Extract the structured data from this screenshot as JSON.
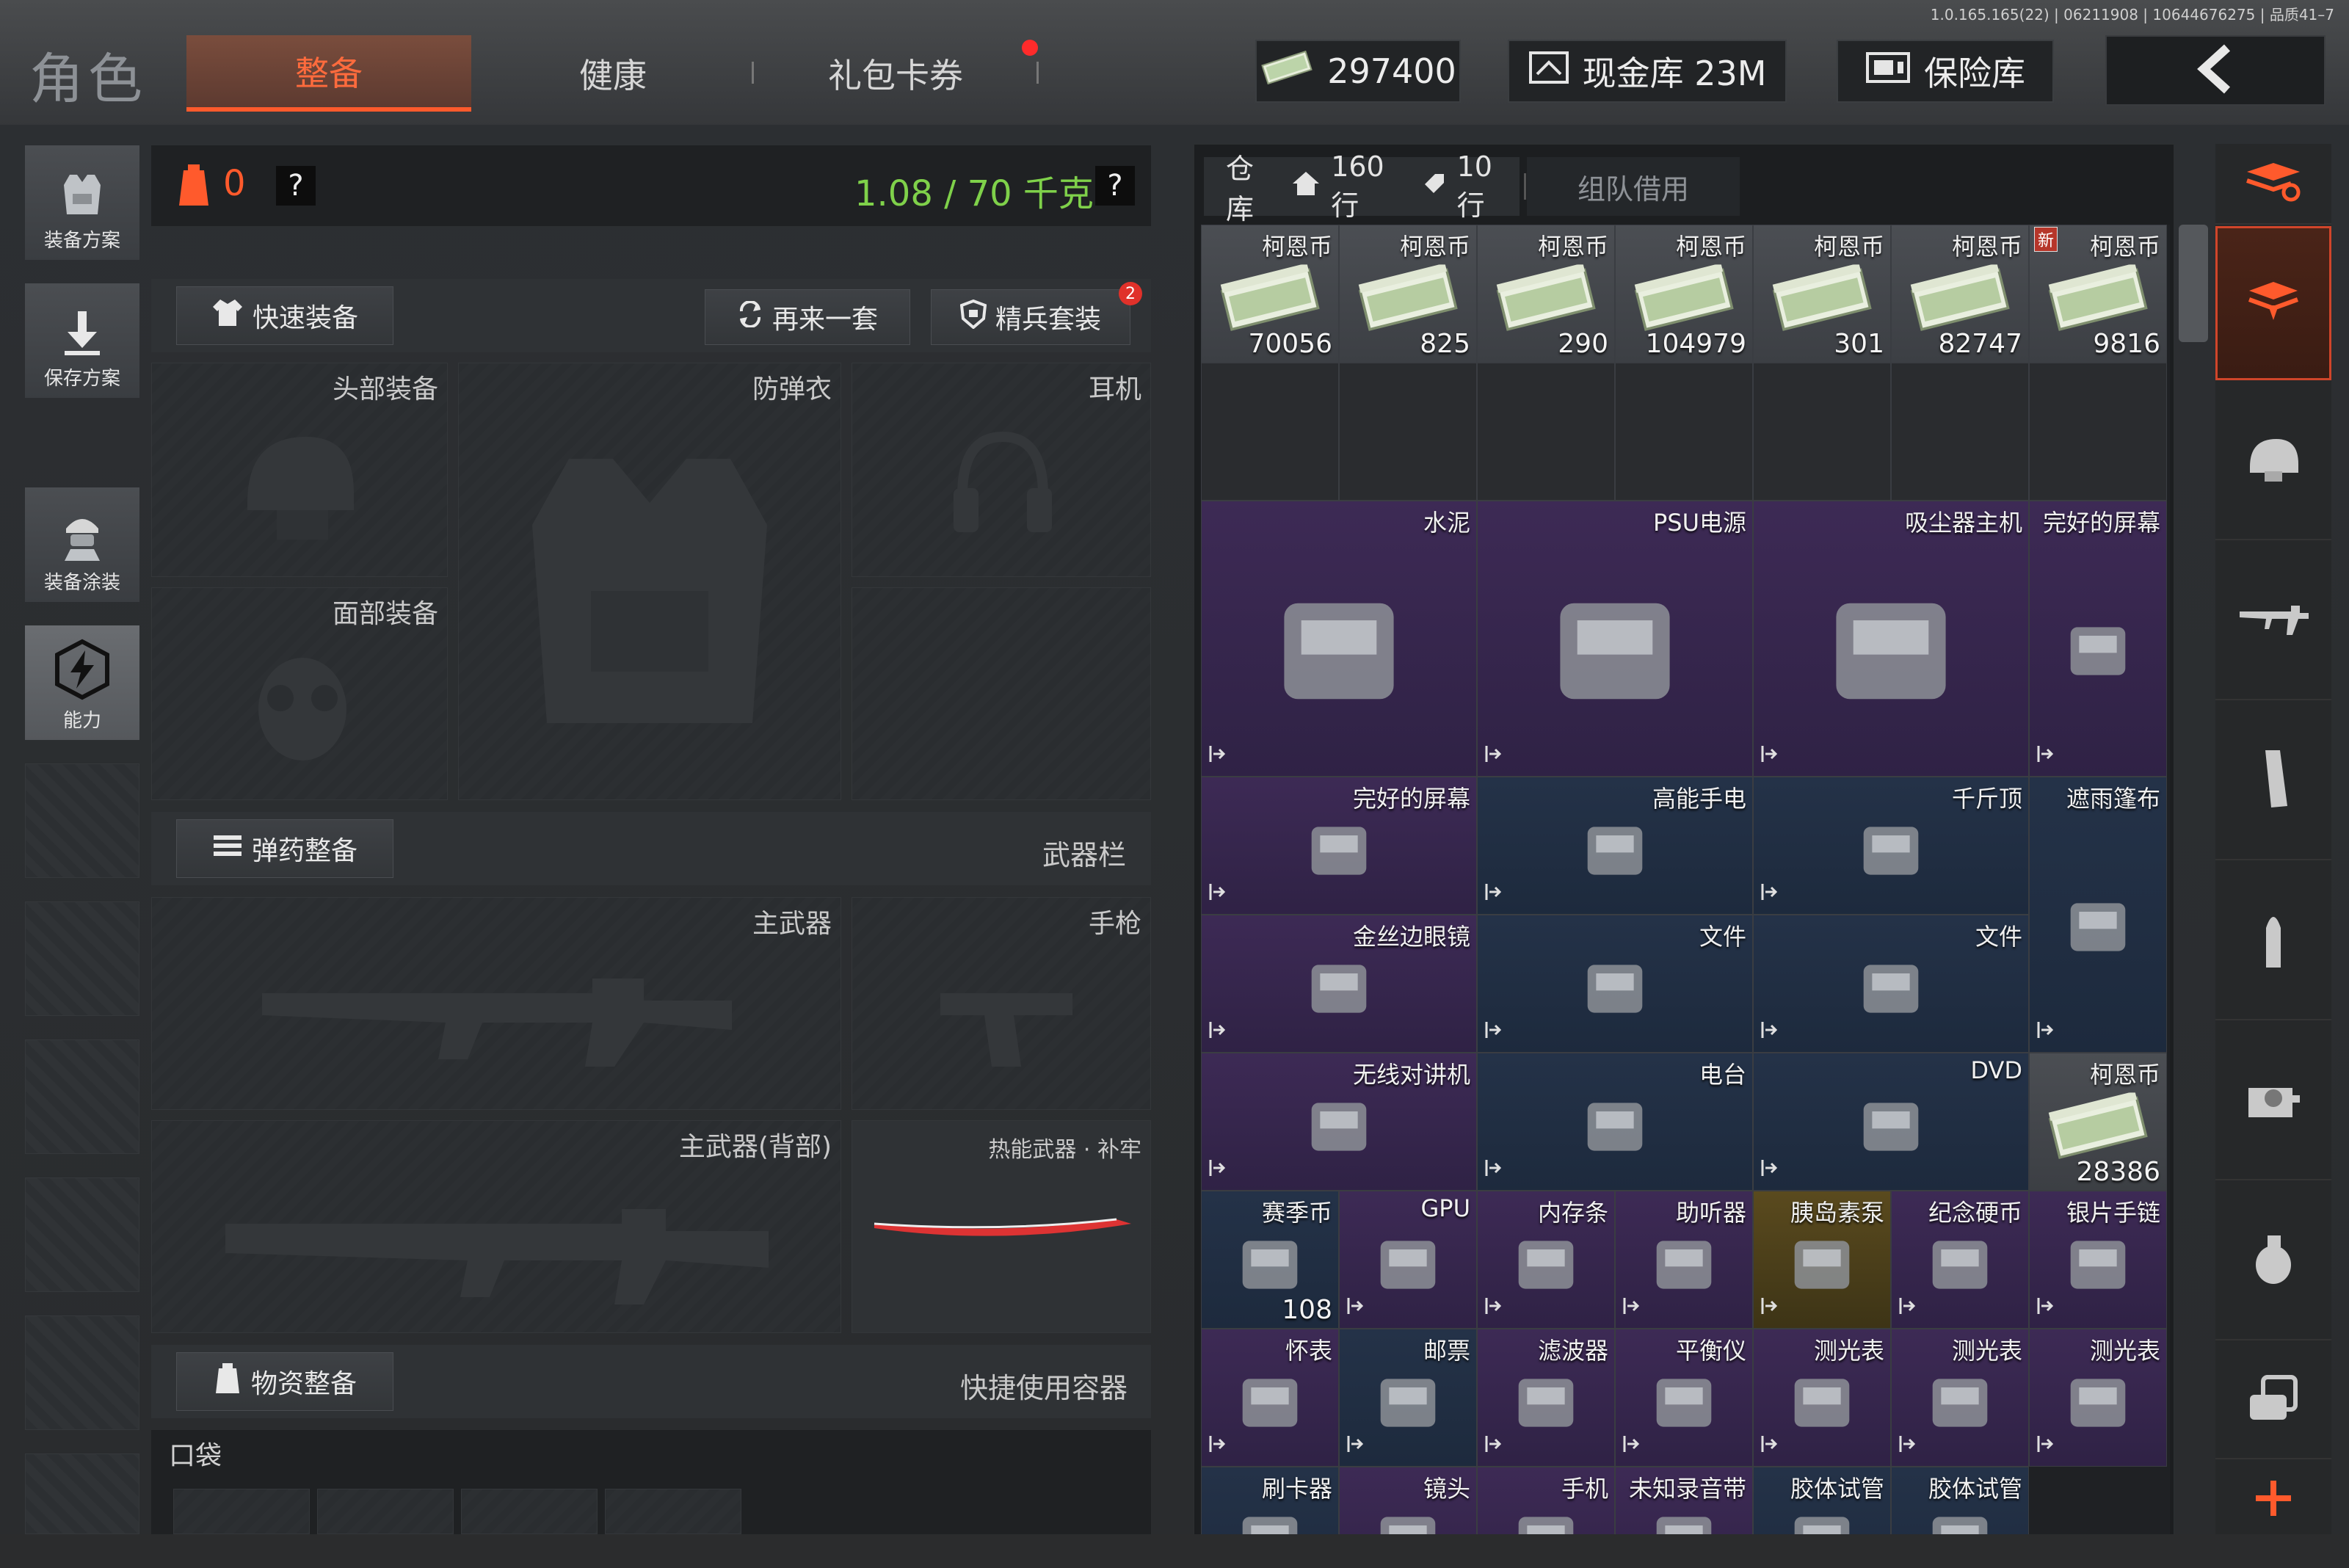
{
  "version": "1.0.165.165(22) | 06211908 | 10644676275 | 品质41–7",
  "title": "角色",
  "tabs": [
    {
      "label": "整备"
    },
    {
      "label": "健康"
    },
    {
      "label": "礼包卡券"
    }
  ],
  "currency": {
    "cash": "297400",
    "vault_label": "现金库 23M",
    "safe_label": "保险库"
  },
  "sidebar": {
    "items": [
      {
        "label": "装备方案"
      },
      {
        "label": "保存方案"
      },
      {
        "label": "装备涂装"
      },
      {
        "label": "能力"
      }
    ]
  },
  "status": {
    "armor_count": "0",
    "help": "?",
    "weight": "1.08 / 70 千克"
  },
  "actions": {
    "quick_equip": "快速装备",
    "retry": "再来一套",
    "elite": "精兵套装",
    "elite_badge": "2"
  },
  "slots": {
    "head": "头部装备",
    "armor": "防弹衣",
    "ear": "耳机",
    "face": "面部装备",
    "primary": "主武器",
    "pistol": "手枪",
    "primary_back": "主武器(背部)",
    "melee": "热能武器 · 补牢"
  },
  "sections": {
    "ammo": "弹药整备",
    "weapon_bar": "武器栏",
    "supply": "物资整备",
    "quick_container": "快捷使用容器",
    "pocket": "口袋"
  },
  "warehouse": {
    "tab_label": "仓库",
    "rows_a": "160行",
    "rows_b": "10行",
    "team_borrow": "组队借用",
    "new_badge": "新"
  },
  "items": [
    {
      "name": "柯恩币",
      "qty": "70056",
      "bg": "gray"
    },
    {
      "name": "柯恩币",
      "qty": "825",
      "bg": "gray"
    },
    {
      "name": "柯恩币",
      "qty": "290",
      "bg": "gray"
    },
    {
      "name": "柯恩币",
      "qty": "104979",
      "bg": "gray"
    },
    {
      "name": "柯恩币",
      "qty": "301",
      "bg": "gray"
    },
    {
      "name": "柯恩币",
      "qty": "82747",
      "bg": "gray"
    },
    {
      "name": "柯恩币",
      "qty": "9816",
      "bg": "gray"
    },
    {
      "name": "水泥",
      "qty": "",
      "bg": "purple"
    },
    {
      "name": "PSU电源",
      "qty": "",
      "bg": "purple"
    },
    {
      "name": "吸尘器主机",
      "qty": "",
      "bg": "purple"
    },
    {
      "name": "完好的屏幕",
      "qty": "",
      "bg": "purple"
    },
    {
      "name": "完好的屏幕",
      "qty": "",
      "bg": "purple"
    },
    {
      "name": "高能手电",
      "qty": "",
      "bg": "blue"
    },
    {
      "name": "千斤顶",
      "qty": "",
      "bg": "blue"
    },
    {
      "name": "遮雨篷布",
      "qty": "",
      "bg": "blue"
    },
    {
      "name": "金丝边眼镜",
      "qty": "",
      "bg": "purple"
    },
    {
      "name": "文件",
      "qty": "",
      "bg": "blue"
    },
    {
      "name": "文件",
      "qty": "",
      "bg": "blue"
    },
    {
      "name": "无线对讲机",
      "qty": "",
      "bg": "purple"
    },
    {
      "name": "电台",
      "qty": "",
      "bg": "blue"
    },
    {
      "name": "DVD",
      "qty": "",
      "bg": "blue"
    },
    {
      "name": "柯恩币",
      "qty": "28386",
      "bg": "gray"
    },
    {
      "name": "赛季币",
      "qty": "108",
      "bg": "blue"
    },
    {
      "name": "GPU",
      "qty": "",
      "bg": "purple"
    },
    {
      "name": "内存条",
      "qty": "",
      "bg": "purple"
    },
    {
      "name": "助听器",
      "qty": "",
      "bg": "purple"
    },
    {
      "name": "胰岛素泵",
      "qty": "",
      "bg": "gold"
    },
    {
      "name": "纪念硬币",
      "qty": "",
      "bg": "purple"
    },
    {
      "name": "银片手链",
      "qty": "",
      "bg": "purple"
    },
    {
      "name": "怀表",
      "qty": "",
      "bg": "purple"
    },
    {
      "name": "邮票",
      "qty": "",
      "bg": "blue"
    },
    {
      "name": "滤波器",
      "qty": "",
      "bg": "purple"
    },
    {
      "name": "平衡仪",
      "qty": "",
      "bg": "purple"
    },
    {
      "name": "测光表",
      "qty": "",
      "bg": "purple"
    },
    {
      "name": "测光表",
      "qty": "",
      "bg": "purple"
    },
    {
      "name": "测光表",
      "qty": "",
      "bg": "purple"
    },
    {
      "name": "刷卡器",
      "qty": "",
      "bg": "blue"
    },
    {
      "name": "镜头",
      "qty": "",
      "bg": "purple"
    },
    {
      "name": "手机",
      "qty": "",
      "bg": "purple"
    },
    {
      "name": "未知录音带",
      "qty": "",
      "bg": "purple"
    },
    {
      "name": "胶体试管",
      "qty": "",
      "bg": "blue"
    },
    {
      "name": "胶体试管",
      "qty": "",
      "bg": "blue"
    }
  ],
  "colors": {
    "accent": "#ff5a2c",
    "weight": "#7fd14a",
    "purple": "#3d2a55",
    "blue": "#243248",
    "gold": "#5a4a1e"
  },
  "icons": [
    "cash-icon",
    "vault-icon",
    "safe-icon",
    "back-arrow-icon",
    "vest-icon",
    "download-icon",
    "soldier-icon",
    "ability-icon",
    "shirt-icon",
    "refresh-icon",
    "shield-icon",
    "ammo-icon",
    "backpack-icon",
    "home-icon",
    "tag-icon",
    "stack-icon",
    "rifle-icon",
    "magazine-icon",
    "bullet-icon",
    "sight-icon",
    "grenade-icon",
    "plus-icon"
  ]
}
